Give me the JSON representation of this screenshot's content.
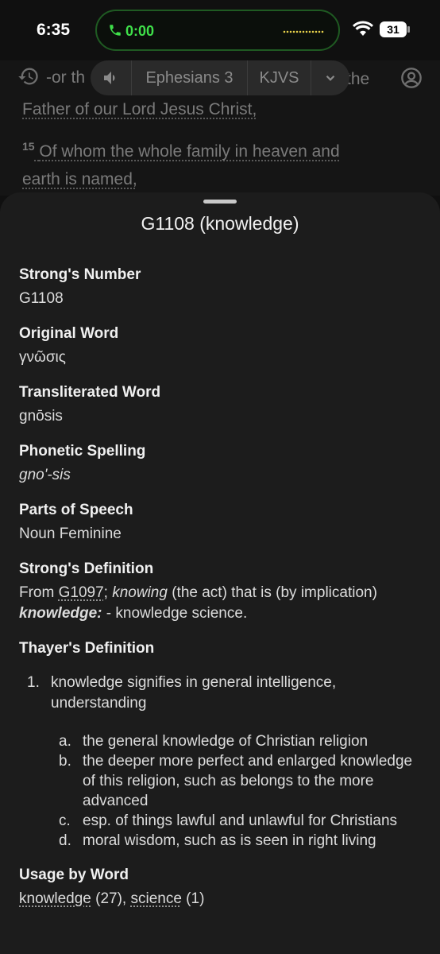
{
  "status": {
    "time": "6:35",
    "call_timer": "0:00",
    "battery": "31"
  },
  "reader": {
    "line1": "-or th",
    "line1_tail": "the",
    "line2": "Father of our Lord Jesus Christ,",
    "verse15_num": "15",
    "line3": "Of whom the whole family in heaven and",
    "line4": "earth is named,"
  },
  "toolbar": {
    "book": "Ephesians 3",
    "version": "KJVS"
  },
  "sheet": {
    "title": "G1108 (knowledge)",
    "strongs_number_label": "Strong's Number",
    "strongs_number": "G1108",
    "original_word_label": "Original Word",
    "original_word": "γνῶσις",
    "transliterated_label": "Transliterated Word",
    "transliterated": "gnōsis",
    "phonetic_label": "Phonetic Spelling",
    "phonetic": "gno'-sis",
    "pos_label": "Parts of Speech",
    "pos": "Noun Feminine",
    "strongs_def_label": "Strong's Definition",
    "strongs_def": {
      "prefix": "From ",
      "ref": "G1097",
      "p1": "; ",
      "knowing": "knowing",
      "p2": " (the act) that is (by implication) ",
      "knowledge": "knowledge:",
      "p3": " - knowledge science."
    },
    "thayer_label": "Thayer's Definition",
    "thayer": {
      "num": "1.",
      "text": "knowledge signifies in general intelligence, understanding",
      "sub": [
        {
          "letter": "a.",
          "text": "the general knowledge of Christian religion"
        },
        {
          "letter": "b.",
          "text": "the deeper more perfect and enlarged knowledge of this religion, such as belongs to the more advanced"
        },
        {
          "letter": "c.",
          "text": "esp. of things lawful and unlawful for Christians"
        },
        {
          "letter": "d.",
          "text": "moral wisdom, such as is seen in right living"
        }
      ]
    },
    "usage_label": "Usage by Word",
    "usage": {
      "w1": "knowledge",
      "c1": " (27), ",
      "w2": "science",
      "c2": " (1)"
    }
  }
}
